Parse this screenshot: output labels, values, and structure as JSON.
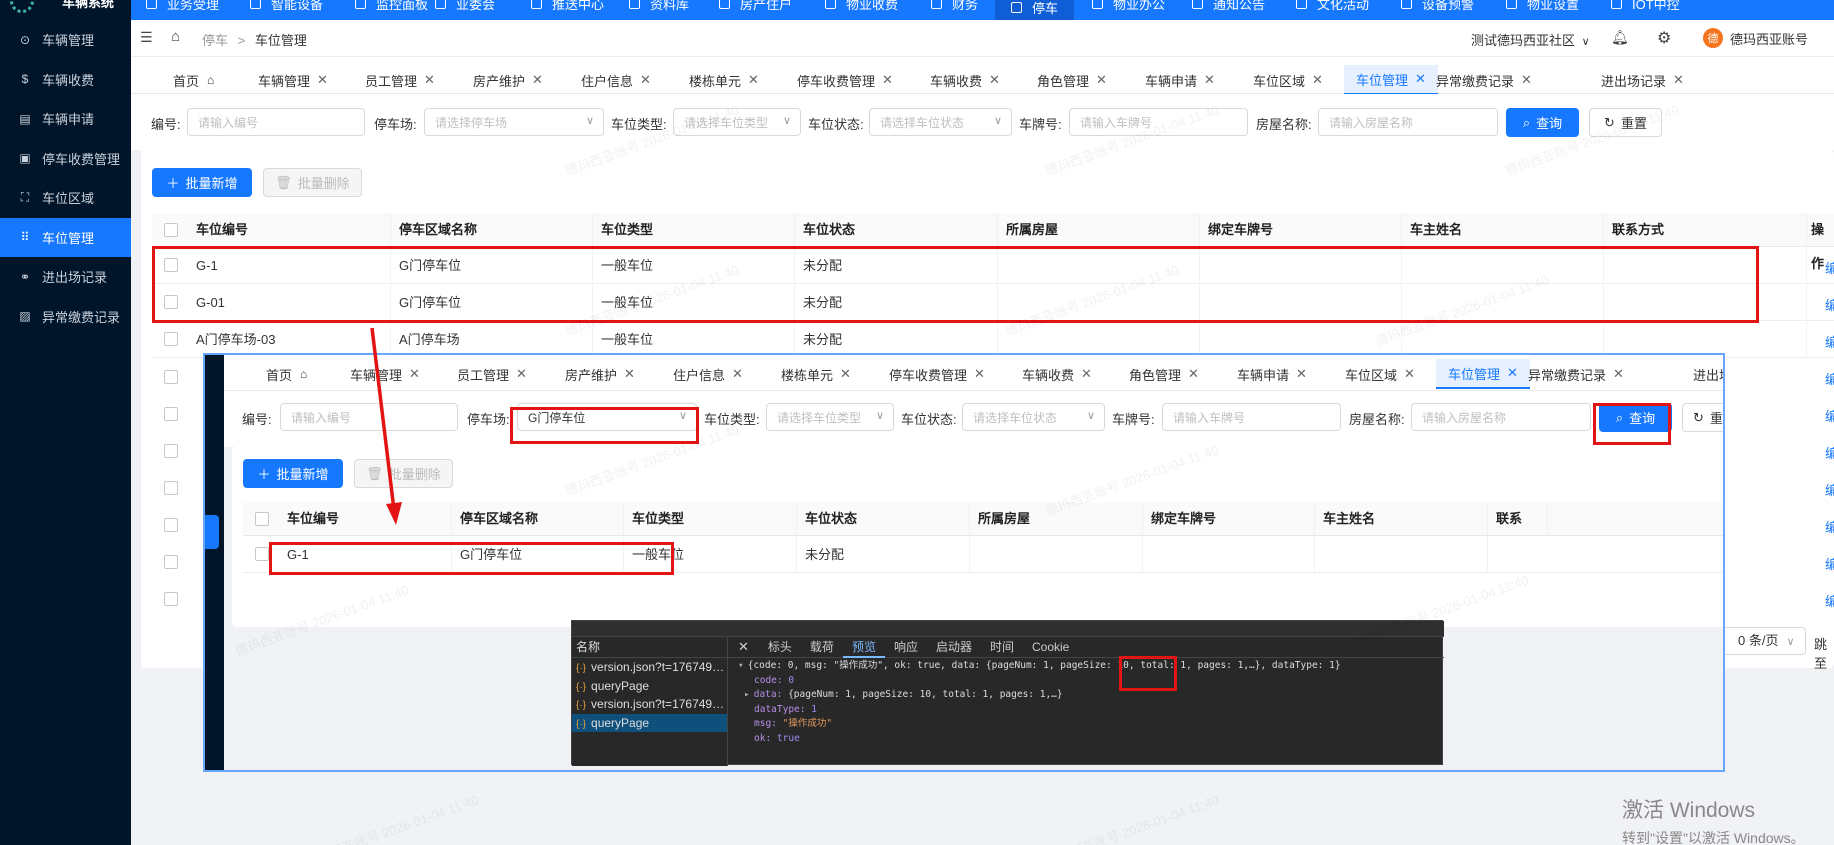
{
  "sidebar": {
    "logo_text": "车辆系统",
    "items": [
      {
        "label": "车辆管理",
        "icon": "car-icon",
        "glyph": "⊙"
      },
      {
        "label": "车辆收费",
        "icon": "coin-icon",
        "glyph": "$"
      },
      {
        "label": "车辆申请",
        "icon": "form-icon",
        "glyph": "▤"
      },
      {
        "label": "停车收费管理",
        "icon": "billing-icon",
        "glyph": "▣"
      },
      {
        "label": "车位区域",
        "icon": "area-icon",
        "glyph": "⛶"
      },
      {
        "label": "车位管理",
        "icon": "grid-icon",
        "glyph": "⠿"
      },
      {
        "label": "进出场记录",
        "icon": "link-icon",
        "glyph": "⚭"
      },
      {
        "label": "异常缴费记录",
        "icon": "alert-doc-icon",
        "glyph": "▨"
      }
    ]
  },
  "topnav": {
    "items": [
      "业务受理",
      "智能设备",
      "监控面板",
      "业委会",
      "推送中心",
      "资料库",
      "房产住户",
      "物业收费",
      "财务",
      "停车",
      "物业办公",
      "通知公告",
      "文化活动",
      "设备预警",
      "物业设置",
      "IOT中控"
    ]
  },
  "header": {
    "breadcrumb_parent": "停车",
    "breadcrumb_sep": ">",
    "breadcrumb_current": "车位管理",
    "community": "测试德玛西亚社区",
    "account": "德玛西亚账号",
    "avatar_char": "德"
  },
  "tabs": [
    "首页",
    "车辆管理",
    "员工管理",
    "房产维护",
    "住户信息",
    "楼栋单元",
    "停车收费管理",
    "车辆收费",
    "角色管理",
    "车辆申请",
    "车位区域",
    "车位管理",
    "异常缴费记录",
    "进出场记录"
  ],
  "filters": {
    "code_label": "编号:",
    "code_placeholder": "请输入编号",
    "lot_label": "停车场:",
    "lot_placeholder": "请选择停车场",
    "type_label": "车位类型:",
    "type_placeholder": "请选择车位类型",
    "status_label": "车位状态:",
    "status_placeholder": "请选择车位状态",
    "plate_label": "车牌号:",
    "plate_placeholder": "请输入车牌号",
    "house_label": "房屋名称:",
    "house_placeholder": "请输入房屋名称",
    "query_label": "查询",
    "reset_label": "重置",
    "reset_short": "重"
  },
  "actions": {
    "batch_add": "批量新增",
    "batch_delete": "批量删除"
  },
  "table": {
    "columns": [
      "车位编号",
      "停车区域名称",
      "车位类型",
      "车位状态",
      "所属房屋",
      "绑定车牌号",
      "车主姓名",
      "联系方式"
    ],
    "col_actions": "操作",
    "col_contact_short": "联系",
    "edit_label": "编",
    "rows": [
      [
        "G-1",
        "G门停车位",
        "一般车位",
        "未分配"
      ],
      [
        "G-01",
        "G门停车位",
        "一般车位",
        "未分配"
      ],
      [
        "A门停车场-03",
        "A门停车场",
        "一般车位",
        "未分配"
      ]
    ]
  },
  "overlay": {
    "lot_selected": "G门停车位",
    "tab_last": "进出场",
    "rows": [
      [
        "G-1",
        "G门停车位",
        "一般车位",
        "未分配"
      ]
    ]
  },
  "pager": {
    "page_size": "0 条/页",
    "jump": "跳至"
  },
  "devtools": {
    "name_header": "名称",
    "requests": [
      "version.json?t=176749…",
      "queryPage",
      "version.json?t=176749…",
      "queryPage"
    ],
    "tabs": [
      "标头",
      "载荷",
      "预览",
      "响应",
      "启动器",
      "时间",
      "Cookie"
    ],
    "active_tab": "预览",
    "summary_head": "{code: 0, msg: \"操作成功\", ok: true, data: {pageNum: 1, pageSize: 10,",
    "summary_total": "total: 1,",
    "summary_tail": "pages: 1,…}, dataType: 1}",
    "code_key": "code:",
    "code_val": "0",
    "data_key": "data:",
    "data_val": "{pageNum: 1, pageSize: 10, total: 1, pages: 1,…}",
    "datatype_key": "dataType:",
    "datatype_val": "1",
    "msg_key": "msg:",
    "msg_val": "\"操作成功\"",
    "ok_key": "ok:",
    "ok_val": "true"
  },
  "watermark": "德玛西亚账号 2026-01-04 11:40",
  "windows": {
    "line1": "激活 Windows",
    "line2": "转到\"设置\"以激活 Windows。"
  },
  "colors": {
    "primary": "#1677ff",
    "sidebar_bg": "#001529",
    "highlight_red": "#e31414",
    "avatar": "#f5741d"
  }
}
